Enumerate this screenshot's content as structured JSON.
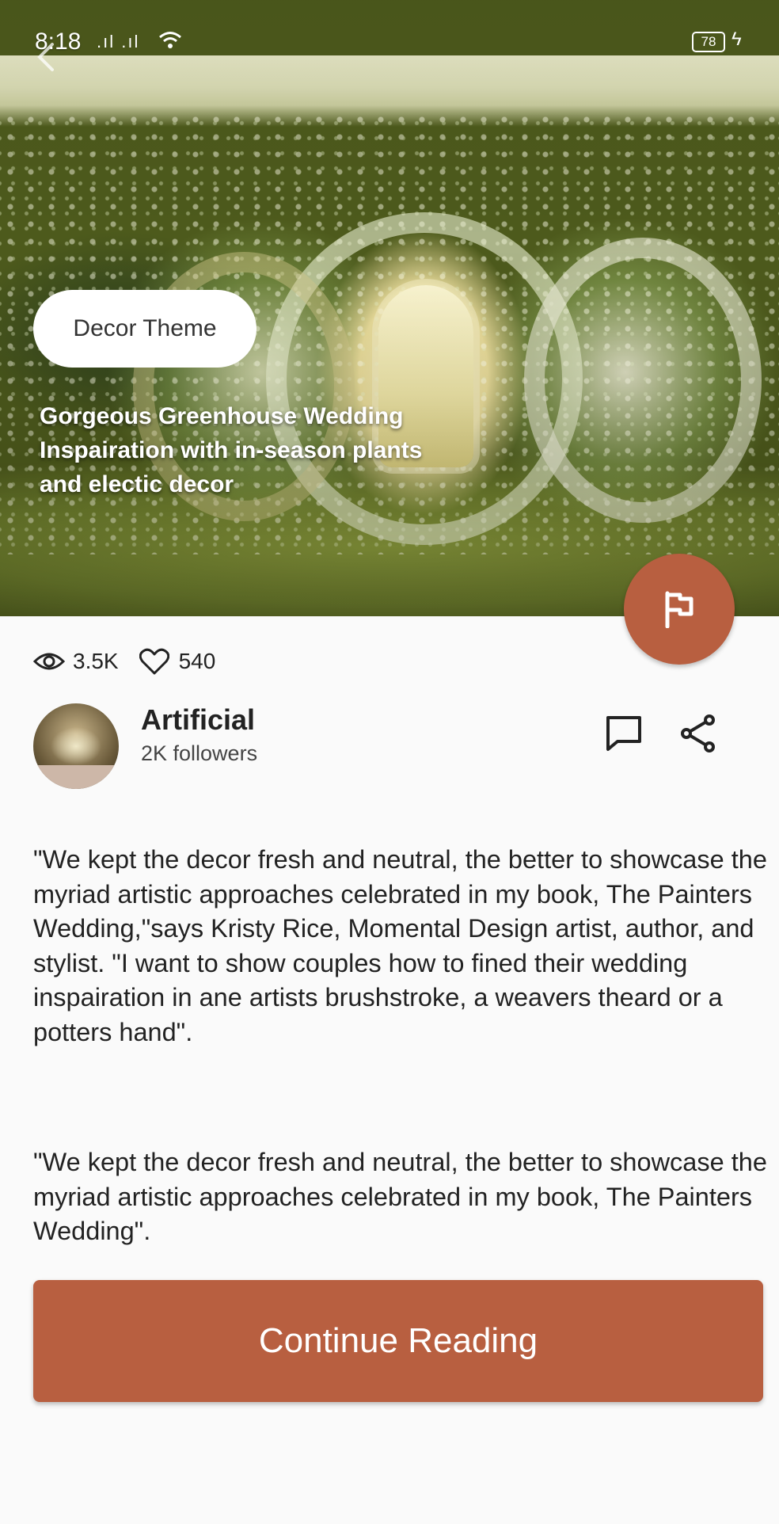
{
  "status_bar": {
    "time": "8:18",
    "signal": ".ıl .ıl",
    "battery": "78"
  },
  "article": {
    "theme_chip": "Decor Theme",
    "title": "Gorgeous Greenhouse Wedding Inspairation with in-season plants and electic decor",
    "views": "3.5K",
    "likes": "540",
    "author": {
      "name": "Artificial",
      "followers": "2K followers"
    },
    "paragraphs": [
      "\"We kept the decor fresh and neutral, the better to showcase the myriad artistic approaches celebrated in my book, The Painters Wedding,\"says Kristy Rice, Momental Design artist, author, and stylist. \"I want to show couples how to fined their wedding inspairation in ane artists brushstroke, a weavers theard or a potters hand\".",
      "\"We kept the decor fresh and neutral, the better to showcase the myriad artistic approaches celebrated in my book, The Painters Wedding\"."
    ],
    "cta_label": "Continue Reading"
  },
  "icons": {
    "back": "arrow-left-icon",
    "flag": "flag-icon",
    "views": "eye-icon",
    "likes": "heart-icon",
    "comment": "comment-icon",
    "share": "share-icon"
  },
  "colors": {
    "accent": "#b85f40",
    "background": "#fafafa",
    "text": "#222222"
  }
}
